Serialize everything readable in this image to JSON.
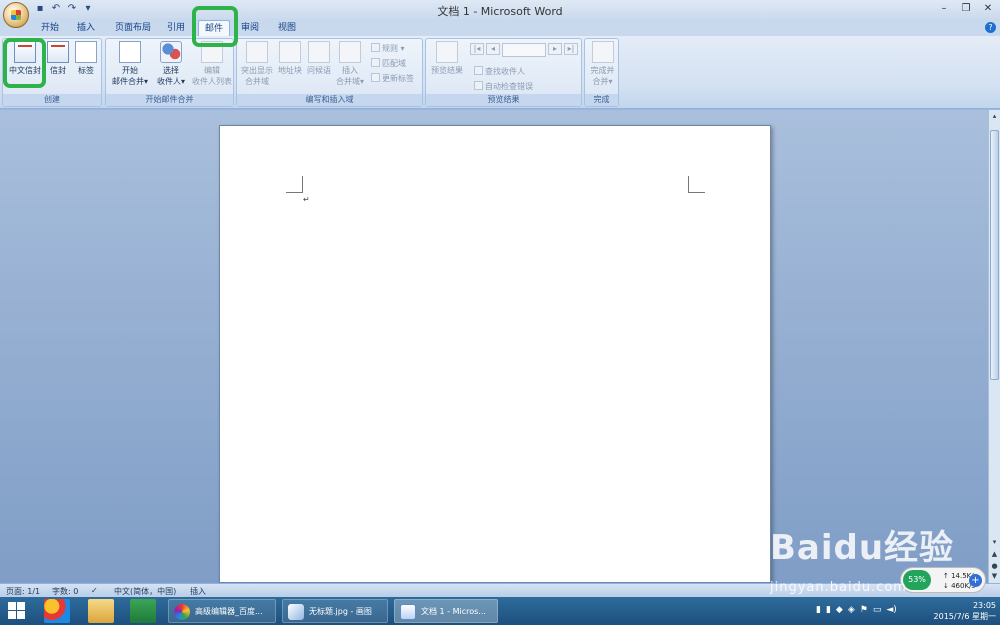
{
  "window": {
    "title": "文档 1 - Microsoft Word",
    "controls": [
      "minimize",
      "restore",
      "close"
    ]
  },
  "quick_access": [
    "save-icon",
    "undo-icon",
    "redo-icon",
    "customize-icon"
  ],
  "tabs": [
    {
      "label": "开始",
      "active": false
    },
    {
      "label": "插入",
      "active": false
    },
    {
      "label": "页面布局",
      "active": false
    },
    {
      "label": "引用",
      "active": false
    },
    {
      "label": "邮件",
      "active": true
    },
    {
      "label": "审阅",
      "active": false
    },
    {
      "label": "视图",
      "active": false
    }
  ],
  "ribbon": {
    "create": {
      "label": "创建",
      "chinese_envelope": "中文信封",
      "envelope": "信封",
      "labels": "标签"
    },
    "start_merge": {
      "label": "开始邮件合并",
      "start_line1": "开始",
      "start_line2": "邮件合并",
      "select_line1": "选择",
      "select_line2": "收件人",
      "edit_line1": "编辑",
      "edit_line2": "收件人列表"
    },
    "write_insert": {
      "label": "编写和插入域",
      "highlight_line1": "突出显示",
      "highlight_line2": "合并域",
      "address_block": "地址块",
      "greeting_line": "问候语",
      "insert_line1": "插入",
      "insert_line2": "合并域",
      "rules": "规则",
      "match_fields": "匹配域",
      "update_labels": "更新标签"
    },
    "preview": {
      "label": "预览结果",
      "preview_results": "预览结果",
      "find_recipient": "查找收件人",
      "auto_check": "自动检查错误"
    },
    "finish": {
      "label": "完成",
      "finish_line1": "完成并",
      "finish_line2": "合并"
    }
  },
  "statusbar": {
    "page": "页面: 1/1",
    "words": "字数: 0",
    "language": "中文(简体，中国)",
    "mode": "插入"
  },
  "taskbar": {
    "windows": [
      {
        "label": "高级编辑器_百度...",
        "active": false
      },
      {
        "label": "无标题.jpg - 画图",
        "active": false
      },
      {
        "label": "文档 1 - Micros...",
        "active": true
      }
    ],
    "time": "23:05",
    "date": "2015/7/6 星期一"
  },
  "net_monitor": {
    "percent": "53%",
    "up": "14.5K/s",
    "down": "460K/s"
  },
  "watermark": {
    "brand": "Baidu经验",
    "url": "jingyan.baidu.com"
  },
  "colors": {
    "highlight": "#2db34a",
    "ribbon_bg": "#dbe6f4",
    "taskbar": "#1d4f7d"
  }
}
